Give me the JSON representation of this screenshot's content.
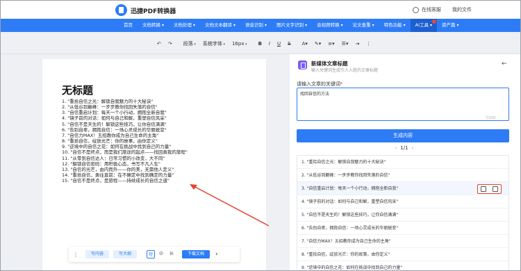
{
  "app": {
    "title": "迅捷PDF转换器"
  },
  "header": {
    "online_support": "在线客服",
    "my_files": "我的文件"
  },
  "nav": [
    {
      "label": "首页",
      "dropdown": false,
      "active": false,
      "hot": false
    },
    {
      "label": "文档转换",
      "dropdown": true,
      "active": false,
      "hot": false
    },
    {
      "label": "文档处理",
      "dropdown": true,
      "active": false,
      "hot": false
    },
    {
      "label": "文档文本翻译",
      "dropdown": true,
      "active": false,
      "hot": false
    },
    {
      "label": "语音识别",
      "dropdown": true,
      "active": false,
      "hot": false
    },
    {
      "label": "图片文字识别",
      "dropdown": true,
      "active": false,
      "hot": false
    },
    {
      "label": "音视频转换",
      "dropdown": true,
      "active": false,
      "hot": false
    },
    {
      "label": "论文查重",
      "dropdown": true,
      "active": false,
      "hot": false
    },
    {
      "label": "特色功能",
      "dropdown": true,
      "active": false,
      "hot": false
    },
    {
      "label": "AI工具",
      "dropdown": true,
      "active": true,
      "hot": true
    },
    {
      "label": "资产篇",
      "dropdown": true,
      "active": false,
      "hot": false
    }
  ],
  "toolbar": {
    "paragraph": "段落",
    "font": "系统字体",
    "size": "16px",
    "bold": "B",
    "italic": "I",
    "underline": "U",
    "strike": "S"
  },
  "document": {
    "title": "无标题",
    "lines": [
      "1. \"重拾自信之光：解锁自我魅力的十大秘诀\"",
      "2. \"从低谷到巅峰：一步步教你找回失落的自信\"",
      "3. \"自信重启计划：每天一个小行动，拥抱全新自我\"",
      "4. \"镜子前的对话：如何与自己和解，重塑自信风采\"",
      "5. \"自信不是天生的！解锁这些技巧，让你自信满满\"",
      "6. \"告别自卑，拥抱自信：一场心灵成长的华丽蜕变\"",
      "7. \"自信力MAX！五招教你成为自己生命的主角\"",
      "8. \"重拾自信，绽放光芒：你的故事，由你定义\"",
      "9. \"逆境中的自信之花：如何在挑战中找到自己的力量\"",
      "10. \"自信不是终点，而是我们旅途的起点——找回真我的旅程\"",
      "11. \"从零到自信达人：日常习惯的小改变，大不同\"",
      "12. \"解锁自信密码：用积极心态，书写不凡人生\"",
      "13. \"自信的光芒，由内而外——你的美，无需他人定义\"",
      "14. \"重拾自信，勇往直前：在不确定中找到确定的力量\"",
      "15. \"自信不是终点，是旅程——持续成长的自信之道\""
    ]
  },
  "bottombar": {
    "write_content": "写内容",
    "write_outline": "写大纲",
    "len_short": "短",
    "len_medium": "中",
    "len_long": "长",
    "download": "下载文档"
  },
  "panel": {
    "title": "新媒体文章标题",
    "subtitle": "输入关键词生成引人入胜的文章标题",
    "keyword_label": "请输入文章的关键词",
    "keyword_value": "找回自信的方法",
    "char_count": "7/100",
    "generate_button": "生成内容",
    "page": "1/1",
    "results": [
      "1. \"重拾自信之光：解锁自我魅力的十大秘诀\"",
      "2. \"从低谷到巅峰：一步步教你找回失落的自信\"",
      "3. \"自信重启计划：每天一个小行动，拥抱全新自我\"",
      "4. \"镜子前的对话：如何与自己和解，重塑自信风采\"",
      "5. \"自信不是天生的！解锁这些技巧，让你自信满满\"",
      "6. \"告别自卑，拥抱自信：一场心灵成长的华丽蜕变\"",
      "7. \"自信力MAX！五招教你成为自己生命的主角\"",
      "8. \"重拾自信，绽放光芒：你的故事，由你定义\"",
      "9. \"逆境中的自信之花：如何在挑战中找到自己的力量\""
    ]
  },
  "colors": {
    "accent": "#2d7cf6",
    "annotation": "#e2452f"
  }
}
